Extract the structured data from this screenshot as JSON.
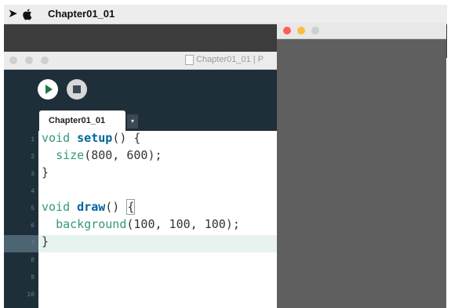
{
  "menubar": {
    "app_name": "Chapter01_01"
  },
  "editor": {
    "window_title": "Chapter01_01 | P",
    "tab_label": "Chapter01_01",
    "tab_menu_symbol": "▾",
    "line_numbers": [
      "1",
      "2",
      "3",
      "4",
      "5",
      "6",
      "7",
      "8",
      "9",
      "10"
    ],
    "code_lines": [
      [
        {
          "t": "void ",
          "c": "kw"
        },
        {
          "t": "setup",
          "c": "fn"
        },
        {
          "t": "() {",
          "c": ""
        }
      ],
      [
        {
          "t": "  ",
          "c": ""
        },
        {
          "t": "size",
          "c": "kw"
        },
        {
          "t": "(800, 600);",
          "c": ""
        }
      ],
      [
        {
          "t": "}",
          "c": ""
        }
      ],
      [],
      [
        {
          "t": "void ",
          "c": "kw"
        },
        {
          "t": "draw",
          "c": "fn"
        },
        {
          "t": "() ",
          "c": ""
        },
        {
          "t": "{",
          "c": "cb"
        }
      ],
      [
        {
          "t": "  ",
          "c": ""
        },
        {
          "t": "background",
          "c": "kw"
        },
        {
          "t": "(100, 100, 100);",
          "c": ""
        }
      ],
      [
        {
          "t": "}",
          "c": ""
        }
      ]
    ],
    "highlighted_line": 7
  },
  "sketch_window": {
    "background_color": "#5f5f5f"
  },
  "colors": {
    "run_green": "#1d7a47",
    "editor_dark": "#253743",
    "keyword": "#33997e",
    "function": "#006699"
  }
}
